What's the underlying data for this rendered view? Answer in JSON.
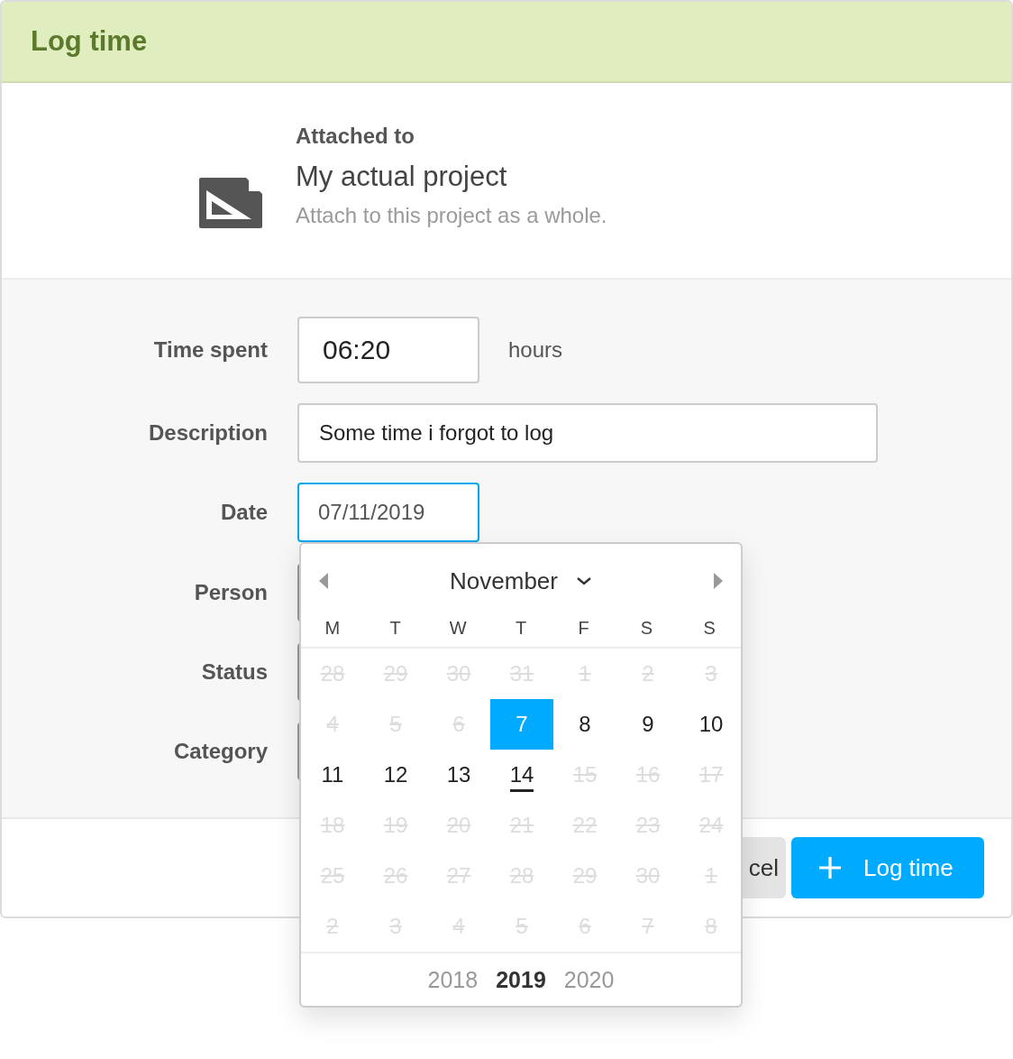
{
  "dialog": {
    "title": "Log time"
  },
  "attachment": {
    "heading": "Attached to",
    "name": "My actual project",
    "hint": "Attach to this project as a whole."
  },
  "form": {
    "fields": [
      {
        "kind": "duration",
        "label": "Time spent",
        "value": "06:20",
        "suffix": "hours",
        "focused": false
      },
      {
        "kind": "text",
        "label": "Description",
        "value": "Some time i forgot to log",
        "focused": false
      },
      {
        "kind": "date",
        "label": "Date",
        "value": "07/11/2019",
        "focused": true
      },
      {
        "kind": "select",
        "label": "Person"
      },
      {
        "kind": "select",
        "label": "Status"
      },
      {
        "kind": "select",
        "label": "Category"
      }
    ]
  },
  "date_picker": {
    "month": "November",
    "weekdays": [
      "M",
      "T",
      "W",
      "T",
      "F",
      "S",
      "S"
    ],
    "weeks": [
      [
        {
          "label": "28",
          "disabled": true,
          "selected": false,
          "today": false
        },
        {
          "label": "29",
          "disabled": true,
          "selected": false,
          "today": false
        },
        {
          "label": "30",
          "disabled": true,
          "selected": false,
          "today": false
        },
        {
          "label": "31",
          "disabled": true,
          "selected": false,
          "today": false
        },
        {
          "label": "1",
          "disabled": true,
          "selected": false,
          "today": false
        },
        {
          "label": "2",
          "disabled": true,
          "selected": false,
          "today": false
        },
        {
          "label": "3",
          "disabled": true,
          "selected": false,
          "today": false
        }
      ],
      [
        {
          "label": "4",
          "disabled": true,
          "selected": false,
          "today": false
        },
        {
          "label": "5",
          "disabled": true,
          "selected": false,
          "today": false
        },
        {
          "label": "6",
          "disabled": true,
          "selected": false,
          "today": false
        },
        {
          "label": "7",
          "disabled": false,
          "selected": true,
          "today": false
        },
        {
          "label": "8",
          "disabled": false,
          "selected": false,
          "today": false
        },
        {
          "label": "9",
          "disabled": false,
          "selected": false,
          "today": false
        },
        {
          "label": "10",
          "disabled": false,
          "selected": false,
          "today": false
        }
      ],
      [
        {
          "label": "11",
          "disabled": false,
          "selected": false,
          "today": false
        },
        {
          "label": "12",
          "disabled": false,
          "selected": false,
          "today": false
        },
        {
          "label": "13",
          "disabled": false,
          "selected": false,
          "today": false
        },
        {
          "label": "14",
          "disabled": false,
          "selected": false,
          "today": true
        },
        {
          "label": "15",
          "disabled": true,
          "selected": false,
          "today": false
        },
        {
          "label": "16",
          "disabled": true,
          "selected": false,
          "today": false
        },
        {
          "label": "17",
          "disabled": true,
          "selected": false,
          "today": false
        }
      ],
      [
        {
          "label": "18",
          "disabled": true,
          "selected": false,
          "today": false
        },
        {
          "label": "19",
          "disabled": true,
          "selected": false,
          "today": false
        },
        {
          "label": "20",
          "disabled": true,
          "selected": false,
          "today": false
        },
        {
          "label": "21",
          "disabled": true,
          "selected": false,
          "today": false
        },
        {
          "label": "22",
          "disabled": true,
          "selected": false,
          "today": false
        },
        {
          "label": "23",
          "disabled": true,
          "selected": false,
          "today": false
        },
        {
          "label": "24",
          "disabled": true,
          "selected": false,
          "today": false
        }
      ],
      [
        {
          "label": "25",
          "disabled": true,
          "selected": false,
          "today": false
        },
        {
          "label": "26",
          "disabled": true,
          "selected": false,
          "today": false
        },
        {
          "label": "27",
          "disabled": true,
          "selected": false,
          "today": false
        },
        {
          "label": "28",
          "disabled": true,
          "selected": false,
          "today": false
        },
        {
          "label": "29",
          "disabled": true,
          "selected": false,
          "today": false
        },
        {
          "label": "30",
          "disabled": true,
          "selected": false,
          "today": false
        },
        {
          "label": "1",
          "disabled": true,
          "selected": false,
          "today": false
        }
      ],
      [
        {
          "label": "2",
          "disabled": true,
          "selected": false,
          "today": false
        },
        {
          "label": "3",
          "disabled": true,
          "selected": false,
          "today": false
        },
        {
          "label": "4",
          "disabled": true,
          "selected": false,
          "today": false
        },
        {
          "label": "5",
          "disabled": true,
          "selected": false,
          "today": false
        },
        {
          "label": "6",
          "disabled": true,
          "selected": false,
          "today": false
        },
        {
          "label": "7",
          "disabled": true,
          "selected": false,
          "today": false
        },
        {
          "label": "8",
          "disabled": true,
          "selected": false,
          "today": false
        }
      ]
    ],
    "years": [
      {
        "label": "2018",
        "selected": false
      },
      {
        "label": "2019",
        "selected": true
      },
      {
        "label": "2020",
        "selected": false
      }
    ]
  },
  "buttons": [
    {
      "kind": "secondary",
      "label": "cel"
    },
    {
      "kind": "primary",
      "label": "Log time"
    }
  ]
}
